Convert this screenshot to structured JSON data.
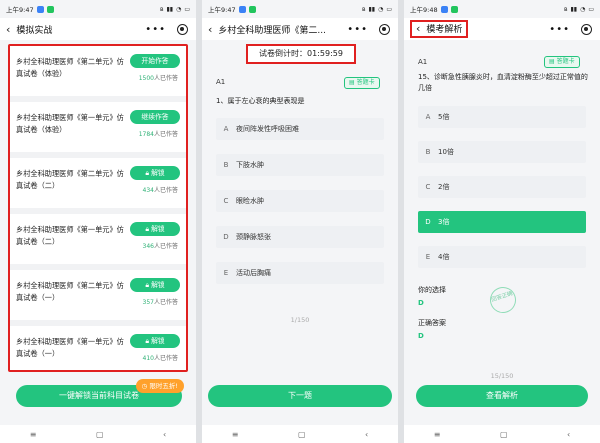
{
  "status": {
    "p1": "上午9:47",
    "p2": "上午9:47",
    "p3": "上午9:48"
  },
  "screen1": {
    "title": "模拟实战",
    "cards": [
      {
        "title": "乡村全科助理医师《第二单元》仿真试卷（体验）",
        "button": "开始作答",
        "count": "1500",
        "count_suffix": "人已作答"
      },
      {
        "title": "乡村全科助理医师《第一单元》仿真试卷（体验）",
        "button": "继续作答",
        "count": "1784",
        "count_suffix": "人已作答"
      },
      {
        "title": "乡村全科助理医师《第二单元》仿真试卷（二）",
        "button": "解锁",
        "count": "434",
        "count_suffix": "人已作答"
      },
      {
        "title": "乡村全科助理医师《第一单元》仿真试卷（二）",
        "button": "解锁",
        "count": "346",
        "count_suffix": "人已作答"
      },
      {
        "title": "乡村全科助理医师《第二单元》仿真试卷（一）",
        "button": "解锁",
        "count": "357",
        "count_suffix": "人已作答"
      },
      {
        "title": "乡村全科助理医师《第一单元》仿真试卷（一）",
        "button": "解锁",
        "count": "410",
        "count_suffix": "人已作答"
      }
    ],
    "promo": "限时五折!",
    "bottom_button": "一键解锁当前科目试卷"
  },
  "screen2": {
    "title": "乡村全科助理医师《第二...",
    "timer_label": "试卷倒计时：",
    "timer_value": "01:59:59",
    "qtype": "A1",
    "sheet": "答题卡",
    "question": "1、属于左心衰的典型表现是",
    "options": [
      {
        "letter": "A",
        "text": "夜间阵发性呼吸困难"
      },
      {
        "letter": "B",
        "text": "下肢水肿"
      },
      {
        "letter": "C",
        "text": "眼睑水肿"
      },
      {
        "letter": "D",
        "text": "颈静脉怒张"
      },
      {
        "letter": "E",
        "text": "活动后胸痛"
      }
    ],
    "page": "1/150",
    "next": "下一题"
  },
  "screen3": {
    "title": "模考解析",
    "qtype": "A1",
    "sheet": "答题卡",
    "question": "15、诊断急性胰腺炎时，血清淀粉酶至少超过正常值的几倍",
    "options": [
      {
        "letter": "A",
        "text": "5倍"
      },
      {
        "letter": "B",
        "text": "10倍"
      },
      {
        "letter": "C",
        "text": "2倍"
      },
      {
        "letter": "D",
        "text": "3倍"
      },
      {
        "letter": "E",
        "text": "4倍"
      }
    ],
    "your_choice_label": "你的选择",
    "your_choice": "D",
    "correct_label": "正确答案",
    "correct": "D",
    "stamp": "回答正确",
    "page": "15/150",
    "view": "查看解析"
  }
}
